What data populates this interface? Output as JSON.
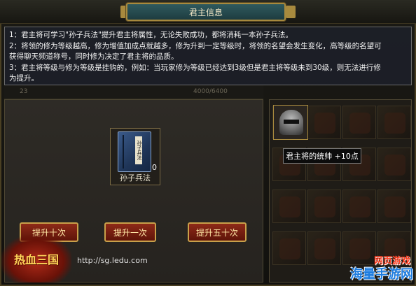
{
  "window": {
    "title": "君主信息"
  },
  "tooltip": {
    "lines": [
      "1：君主将可学习\"孙子兵法\"提升君主将属性，无论失败成功，都将消耗一本孙子兵法。",
      "2：将领的修为等级越高，修为增值加成点就越多，修为升到一定等级时，将领的名望会发生变化，高等级的名望可",
      "获得聊天频道称号，同时修为决定了君主将的品质。",
      "3：君主将等级与修为等级是挂钩的，例如：当玩家修为等级已经达到3级但是君主将等级未到30级，则无法进行修",
      "为提升。"
    ]
  },
  "strip": {
    "left_label": "23",
    "right_label": "4000/6400"
  },
  "item": {
    "name": "孙子兵法",
    "count": "0",
    "cover_text": "孙子兵法"
  },
  "buttons": {
    "ten": "提升十次",
    "one": "提升一次",
    "fifty": "提升五十次"
  },
  "equipment": {
    "tooltip": "君主将的统帅 +10点",
    "helmet_icon": "helmet-icon"
  },
  "footer": {
    "url": "http://sg.ledu.com",
    "logo_left": "热血三国",
    "logo_right_top": "网页游戏",
    "logo_right_bottom": "海量手游网"
  },
  "colors": {
    "title_plate": "#2f5a5e",
    "gold_border": "#a88a3e",
    "button_red": "#8e2a18",
    "button_text": "#ffe7a6"
  }
}
